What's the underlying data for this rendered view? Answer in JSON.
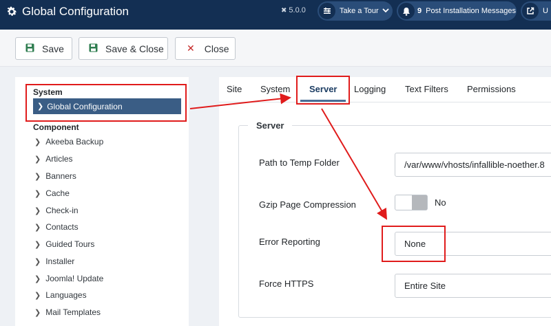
{
  "header": {
    "title": "Global Configuration",
    "version": "5.0.0",
    "tour_label": "Take a Tour",
    "post_count": "9",
    "post_label": "Post Installation Messages",
    "ui_label": "U"
  },
  "toolbar": {
    "save_label": "Save",
    "save_close_label": "Save & Close",
    "close_label": "Close"
  },
  "sidebar": {
    "system_heading": "System",
    "active_item": "Global Configuration",
    "component_heading": "Component",
    "items": [
      {
        "label": "Akeeba Backup"
      },
      {
        "label": "Articles"
      },
      {
        "label": "Banners"
      },
      {
        "label": "Cache"
      },
      {
        "label": "Check-in"
      },
      {
        "label": "Contacts"
      },
      {
        "label": "Guided Tours"
      },
      {
        "label": "Installer"
      },
      {
        "label": "Joomla! Update"
      },
      {
        "label": "Languages"
      },
      {
        "label": "Mail Templates"
      }
    ]
  },
  "tabs": {
    "site": "Site",
    "system": "System",
    "server": "Server",
    "logging": "Logging",
    "text_filters": "Text Filters",
    "permissions": "Permissions",
    "active": "Server"
  },
  "server": {
    "legend": "Server",
    "temp_label": "Path to Temp Folder",
    "temp_value": "/var/www/vhosts/infallible-noether.8",
    "gzip_label": "Gzip Page Compression",
    "gzip_value": "No",
    "error_label": "Error Reporting",
    "error_value": "None",
    "https_label": "Force HTTPS",
    "https_value": "Entire Site"
  },
  "colors": {
    "header_bg": "#132f53",
    "active_item_bg": "#3a5d85",
    "annotation_red": "#e01b1b",
    "close_icon": "#c52827",
    "save_icon": "#2e7d4f"
  },
  "icons": [
    "gear-icon",
    "joomla-icon",
    "tour-icon",
    "chevron-down-icon",
    "bell-icon",
    "external-link-icon",
    "save-icon",
    "close-icon",
    "chevron-right-icon"
  ]
}
